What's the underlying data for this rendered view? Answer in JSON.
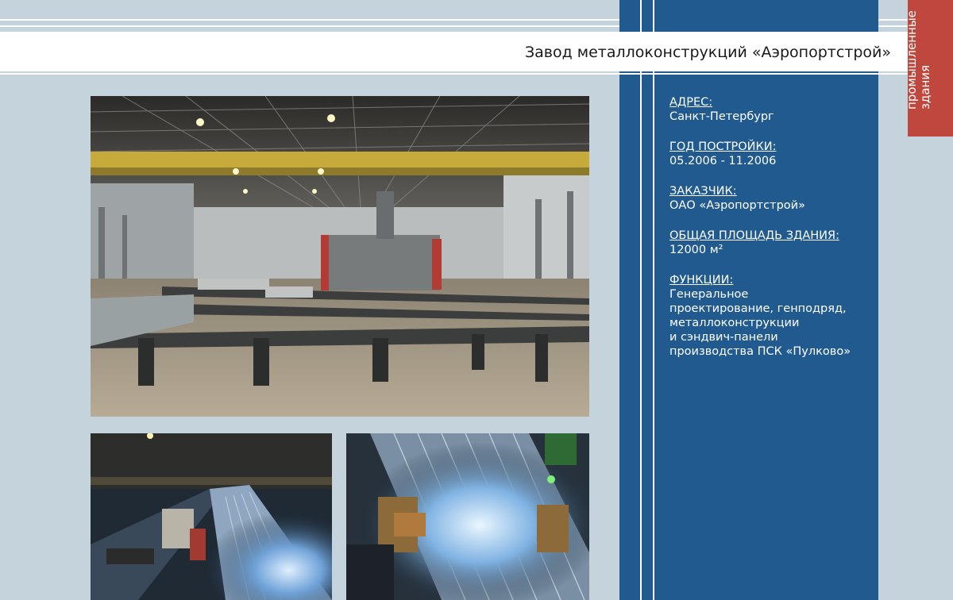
{
  "header": {
    "title": "Завод металлоконструкций «Аэропортстрой»"
  },
  "category_tag": {
    "line1": "промышленные",
    "line2": "здания"
  },
  "info": [
    {
      "label": "АДРЕС:",
      "lines": [
        "Санкт-Петербург"
      ]
    },
    {
      "label": "ГОД ПОСТРОЙКИ:",
      "lines": [
        "05.2006 - 11.2006"
      ]
    },
    {
      "label": "ЗАКАЗЧИК:",
      "lines": [
        "ОАО «Аэропортстрой»"
      ]
    },
    {
      "label": "ОБЩАЯ ПЛОЩАДЬ ЗДАНИЯ:",
      "lines": [
        "12000 м²"
      ]
    },
    {
      "label": "ФУНКЦИИ:",
      "lines": [
        "Генеральное",
        "проектирование, генподряд,",
        "металлоконструкции",
        "и сэндвич-панели",
        "производства ПСК «Пулково»"
      ]
    }
  ],
  "colors": {
    "background": "#c5d3dc",
    "column_blue": "#215a8f",
    "tag_red": "#c0473d"
  }
}
